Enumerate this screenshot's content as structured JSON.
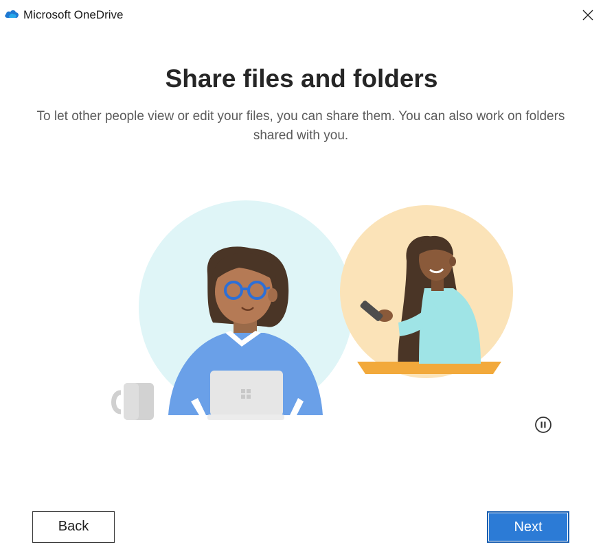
{
  "window": {
    "title": "Microsoft OneDrive",
    "close_icon": "close-icon",
    "logo_icon": "onedrive-cloud-icon"
  },
  "content": {
    "heading": "Share files and folders",
    "subtitle": "To let other people view or edit your files, you can share them. You can also work on folders shared with you."
  },
  "media": {
    "pause_icon": "pause-icon"
  },
  "footer": {
    "back_label": "Back",
    "next_label": "Next"
  },
  "colors": {
    "accent": "#2c7bd6",
    "brand_cloud": "#1f78d1",
    "circle_left": "#dff5f7",
    "circle_right": "#fbe3b8"
  }
}
